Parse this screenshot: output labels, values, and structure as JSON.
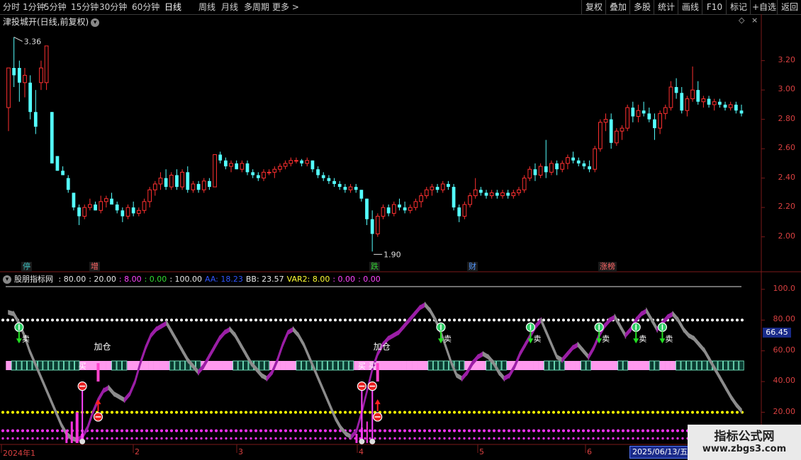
{
  "toolbar": {
    "periods": [
      "分时",
      "1分钟",
      "5分钟",
      "15分钟",
      "30分钟",
      "60分钟",
      "日线",
      "周线",
      "月线",
      "多周期",
      "更多 >"
    ],
    "active_period": "日线",
    "right_buttons": [
      "复权",
      "叠加",
      "多股",
      "统计",
      "画线",
      "F10",
      "标记",
      "+自选",
      "返回"
    ]
  },
  "stock": {
    "title": "津投城开(日线,前复权)",
    "high_label": "3.36",
    "low_label": "1.90"
  },
  "indicator": {
    "name": "股朋指标网",
    "params": [
      {
        "text": ": 80.00",
        "color": "#e8e8e8"
      },
      {
        "text": ": 20.00",
        "color": "#e8e8e8"
      },
      {
        "text": ": 8.00",
        "color": "#ff44ff"
      },
      {
        "text": ": 0.00",
        "color": "#33dd33"
      },
      {
        "text": ": 100.00",
        "color": "#e8e8e8"
      },
      {
        "text": "AA: 18.23",
        "color": "#2f55ff"
      },
      {
        "text": "BB: 23.57",
        "color": "#e8e8e8"
      },
      {
        "text": "VAR2: 8.00",
        "color": "#ffff33"
      },
      {
        "text": ": 0.00",
        "color": "#ff44ff"
      },
      {
        "text": ": 0.00",
        "color": "#ff44ff"
      }
    ],
    "current_value": "66.45",
    "buy_label": "买",
    "sell_label": "卖",
    "add_label": "加仓"
  },
  "price_axis": [
    "3.20",
    "3.00",
    "2.80",
    "2.60",
    "2.40",
    "2.20",
    "2.00"
  ],
  "ind_axis": [
    "100.0",
    "80.00",
    "60.00",
    "40.00",
    "20.00"
  ],
  "event_tags": [
    {
      "text": "停",
      "color": "#3fbfbf"
    },
    {
      "text": "增",
      "color": "#ff6666"
    },
    {
      "text": "跌",
      "color": "#33cc33"
    },
    {
      "text": "财",
      "color": "#5599ff"
    },
    {
      "text": "涨榜",
      "color": "#ff6666"
    }
  ],
  "dates": [
    "2024年1",
    "2",
    "3",
    "4",
    "5",
    "6"
  ],
  "cursor_date": "2025/06/13/五",
  "watermark": {
    "name": "指标公式网",
    "url": "www.zbgs3.com"
  },
  "colors": {
    "up": "#ff3030",
    "down": "#54ffff",
    "purple": "#9b1ea6",
    "gray": "#8c8c8c",
    "pink": "#ff99ee",
    "yellow": "#ffff00",
    "magenta": "#ff33ff"
  },
  "chart_data": {
    "type": "candlestick",
    "ylim": [
      1.82,
      3.42
    ],
    "ohlc": [
      [
        2.88,
        3.05,
        2.72,
        3.15
      ],
      [
        3.15,
        3.36,
        3.02,
        3.1
      ],
      [
        3.15,
        3.2,
        2.92,
        3.05
      ],
      [
        3.05,
        3.15,
        2.95,
        3.1
      ],
      [
        3.05,
        3.1,
        2.8,
        2.85
      ],
      [
        2.85,
        3.0,
        2.7,
        2.75
      ],
      [
        3.05,
        3.2,
        3.0,
        3.15
      ],
      [
        3.05,
        3.3,
        3.0,
        3.3
      ],
      [
        2.85,
        2.85,
        2.5,
        2.5
      ],
      [
        2.55,
        2.55,
        2.45,
        2.45
      ],
      [
        2.45,
        2.48,
        2.42,
        2.42
      ],
      [
        2.4,
        2.42,
        2.3,
        2.32
      ],
      [
        2.3,
        2.3,
        2.18,
        2.2
      ],
      [
        2.2,
        2.22,
        2.08,
        2.14
      ],
      [
        2.14,
        2.22,
        2.12,
        2.2
      ],
      [
        2.2,
        2.26,
        2.18,
        2.22
      ],
      [
        2.22,
        2.24,
        2.18,
        2.18
      ],
      [
        2.18,
        2.28,
        2.16,
        2.24
      ],
      [
        2.24,
        2.28,
        2.2,
        2.26
      ],
      [
        2.26,
        2.3,
        2.22,
        2.22
      ],
      [
        2.22,
        2.24,
        2.16,
        2.18
      ],
      [
        2.18,
        2.2,
        2.1,
        2.14
      ],
      [
        2.14,
        2.22,
        2.12,
        2.2
      ],
      [
        2.2,
        2.24,
        2.14,
        2.16
      ],
      [
        2.16,
        2.2,
        2.14,
        2.18
      ],
      [
        2.18,
        2.26,
        2.16,
        2.24
      ],
      [
        2.24,
        2.34,
        2.2,
        2.32
      ],
      [
        2.32,
        2.38,
        2.28,
        2.36
      ],
      [
        2.36,
        2.44,
        2.32,
        2.4
      ],
      [
        2.4,
        2.46,
        2.32,
        2.34
      ],
      [
        2.34,
        2.44,
        2.32,
        2.42
      ],
      [
        2.42,
        2.46,
        2.32,
        2.34
      ],
      [
        2.34,
        2.46,
        2.32,
        2.44
      ],
      [
        2.44,
        2.48,
        2.3,
        2.32
      ],
      [
        2.32,
        2.38,
        2.3,
        2.36
      ],
      [
        2.36,
        2.38,
        2.3,
        2.32
      ],
      [
        2.32,
        2.4,
        2.3,
        2.38
      ],
      [
        2.38,
        2.4,
        2.32,
        2.34
      ],
      [
        2.34,
        2.56,
        2.34,
        2.56
      ],
      [
        2.56,
        2.58,
        2.5,
        2.52
      ],
      [
        2.52,
        2.54,
        2.46,
        2.48
      ],
      [
        2.48,
        2.52,
        2.44,
        2.5
      ],
      [
        2.5,
        2.52,
        2.46,
        2.46
      ],
      [
        2.46,
        2.52,
        2.44,
        2.5
      ],
      [
        2.5,
        2.52,
        2.42,
        2.44
      ],
      [
        2.44,
        2.46,
        2.4,
        2.42
      ],
      [
        2.42,
        2.44,
        2.38,
        2.4
      ],
      [
        2.4,
        2.46,
        2.38,
        2.44
      ],
      [
        2.44,
        2.46,
        2.42,
        2.44
      ],
      [
        2.44,
        2.48,
        2.4,
        2.46
      ],
      [
        2.46,
        2.5,
        2.44,
        2.48
      ],
      [
        2.48,
        2.52,
        2.46,
        2.5
      ],
      [
        2.5,
        2.54,
        2.48,
        2.52
      ],
      [
        2.52,
        2.54,
        2.5,
        2.52
      ],
      [
        2.52,
        2.53,
        2.48,
        2.5
      ],
      [
        2.5,
        2.54,
        2.48,
        2.52
      ],
      [
        2.52,
        2.52,
        2.44,
        2.46
      ],
      [
        2.46,
        2.48,
        2.4,
        2.42
      ],
      [
        2.42,
        2.44,
        2.38,
        2.4
      ],
      [
        2.4,
        2.42,
        2.36,
        2.38
      ],
      [
        2.38,
        2.4,
        2.34,
        2.36
      ],
      [
        2.36,
        2.38,
        2.32,
        2.34
      ],
      [
        2.34,
        2.36,
        2.3,
        2.32
      ],
      [
        2.32,
        2.36,
        2.3,
        2.34
      ],
      [
        2.34,
        2.36,
        2.3,
        2.32
      ],
      [
        2.32,
        2.32,
        2.24,
        2.26
      ],
      [
        2.26,
        2.26,
        2.08,
        2.12
      ],
      [
        2.12,
        2.18,
        1.9,
        2.02
      ],
      [
        2.02,
        2.16,
        2.0,
        2.14
      ],
      [
        2.14,
        2.22,
        2.12,
        2.2
      ],
      [
        2.2,
        2.22,
        2.14,
        2.16
      ],
      [
        2.16,
        2.24,
        2.14,
        2.22
      ],
      [
        2.22,
        2.26,
        2.18,
        2.2
      ],
      [
        2.2,
        2.24,
        2.16,
        2.18
      ],
      [
        2.18,
        2.22,
        2.16,
        2.2
      ],
      [
        2.2,
        2.26,
        2.18,
        2.24
      ],
      [
        2.24,
        2.3,
        2.2,
        2.28
      ],
      [
        2.28,
        2.34,
        2.26,
        2.32
      ],
      [
        2.32,
        2.36,
        2.28,
        2.34
      ],
      [
        2.34,
        2.36,
        2.3,
        2.32
      ],
      [
        2.32,
        2.38,
        2.3,
        2.36
      ],
      [
        2.36,
        2.38,
        2.32,
        2.34
      ],
      [
        2.34,
        2.36,
        2.18,
        2.2
      ],
      [
        2.2,
        2.22,
        2.1,
        2.14
      ],
      [
        2.14,
        2.24,
        2.12,
        2.22
      ],
      [
        2.22,
        2.3,
        2.2,
        2.28
      ],
      [
        2.28,
        2.4,
        2.26,
        2.32
      ],
      [
        2.32,
        2.34,
        2.28,
        2.3
      ],
      [
        2.3,
        2.32,
        2.26,
        2.28
      ],
      [
        2.28,
        2.32,
        2.26,
        2.3
      ],
      [
        2.3,
        2.32,
        2.26,
        2.28
      ],
      [
        2.28,
        2.32,
        2.26,
        2.3
      ],
      [
        2.3,
        2.32,
        2.26,
        2.28
      ],
      [
        2.28,
        2.32,
        2.26,
        2.3
      ],
      [
        2.3,
        2.34,
        2.28,
        2.32
      ],
      [
        2.32,
        2.42,
        2.3,
        2.4
      ],
      [
        2.4,
        2.48,
        2.38,
        2.46
      ],
      [
        2.46,
        2.5,
        2.38,
        2.42
      ],
      [
        2.42,
        2.5,
        2.4,
        2.48
      ],
      [
        2.48,
        2.66,
        2.4,
        2.44
      ],
      [
        2.44,
        2.52,
        2.42,
        2.5
      ],
      [
        2.5,
        2.52,
        2.42,
        2.46
      ],
      [
        2.46,
        2.52,
        2.44,
        2.5
      ],
      [
        2.5,
        2.56,
        2.46,
        2.54
      ],
      [
        2.54,
        2.58,
        2.5,
        2.52
      ],
      [
        2.52,
        2.54,
        2.48,
        2.5
      ],
      [
        2.5,
        2.52,
        2.46,
        2.48
      ],
      [
        2.48,
        2.52,
        2.44,
        2.46
      ],
      [
        2.46,
        2.62,
        2.44,
        2.6
      ],
      [
        2.6,
        2.8,
        2.58,
        2.78
      ],
      [
        2.78,
        2.84,
        2.72,
        2.8
      ],
      [
        2.8,
        2.84,
        2.6,
        2.64
      ],
      [
        2.64,
        2.74,
        2.62,
        2.72
      ],
      [
        2.72,
        2.76,
        2.66,
        2.74
      ],
      [
        2.74,
        2.9,
        2.72,
        2.88
      ],
      [
        2.88,
        2.92,
        2.78,
        2.82
      ],
      [
        2.82,
        2.9,
        2.78,
        2.86
      ],
      [
        2.86,
        2.92,
        2.82,
        2.84
      ],
      [
        2.84,
        2.88,
        2.78,
        2.8
      ],
      [
        2.8,
        2.84,
        2.66,
        2.74
      ],
      [
        2.74,
        2.86,
        2.7,
        2.84
      ],
      [
        2.84,
        2.9,
        2.8,
        2.88
      ],
      [
        2.88,
        3.06,
        2.86,
        3.02
      ],
      [
        3.02,
        3.08,
        2.94,
        2.98
      ],
      [
        2.98,
        3.02,
        2.84,
        2.86
      ],
      [
        2.86,
        2.96,
        2.82,
        2.94
      ],
      [
        2.94,
        3.16,
        2.92,
        3.0
      ],
      [
        3.0,
        3.06,
        2.9,
        2.92
      ],
      [
        2.92,
        2.96,
        2.88,
        2.94
      ],
      [
        2.94,
        2.96,
        2.88,
        2.9
      ],
      [
        2.9,
        2.94,
        2.86,
        2.92
      ],
      [
        2.92,
        2.94,
        2.88,
        2.9
      ],
      [
        2.9,
        2.92,
        2.86,
        2.88
      ],
      [
        2.88,
        2.92,
        2.86,
        2.9
      ],
      [
        2.9,
        2.92,
        2.84,
        2.86
      ],
      [
        2.86,
        2.9,
        2.82,
        2.84
      ]
    ],
    "indicator_ylim": [
      0,
      105
    ],
    "oscillator": [
      85,
      84,
      78,
      70,
      60,
      52,
      44,
      36,
      28,
      20,
      12,
      6,
      3,
      2,
      4,
      10,
      20,
      28,
      34,
      36,
      32,
      30,
      28,
      32,
      40,
      52,
      62,
      70,
      74,
      76,
      78,
      72,
      66,
      60,
      54,
      50,
      46,
      50,
      56,
      62,
      68,
      72,
      74,
      70,
      64,
      58,
      52,
      48,
      44,
      42,
      46,
      54,
      64,
      72,
      74,
      70,
      64,
      56,
      48,
      40,
      32,
      24,
      16,
      10,
      6,
      4,
      8,
      20,
      34,
      48,
      58,
      64,
      68,
      70,
      72,
      76,
      80,
      84,
      88,
      90,
      86,
      80,
      72,
      62,
      52,
      44,
      42,
      46,
      52,
      56,
      58,
      56,
      52,
      46,
      42,
      44,
      50,
      58,
      64,
      70,
      76,
      80,
      72,
      64,
      56,
      54,
      58,
      62,
      64,
      60,
      56,
      62,
      70,
      76,
      80,
      82,
      76,
      70,
      74,
      80,
      84,
      86,
      80,
      74,
      78,
      82,
      84,
      80,
      74,
      70,
      68,
      64,
      60,
      54,
      48,
      42,
      36,
      30,
      25,
      21
    ]
  }
}
